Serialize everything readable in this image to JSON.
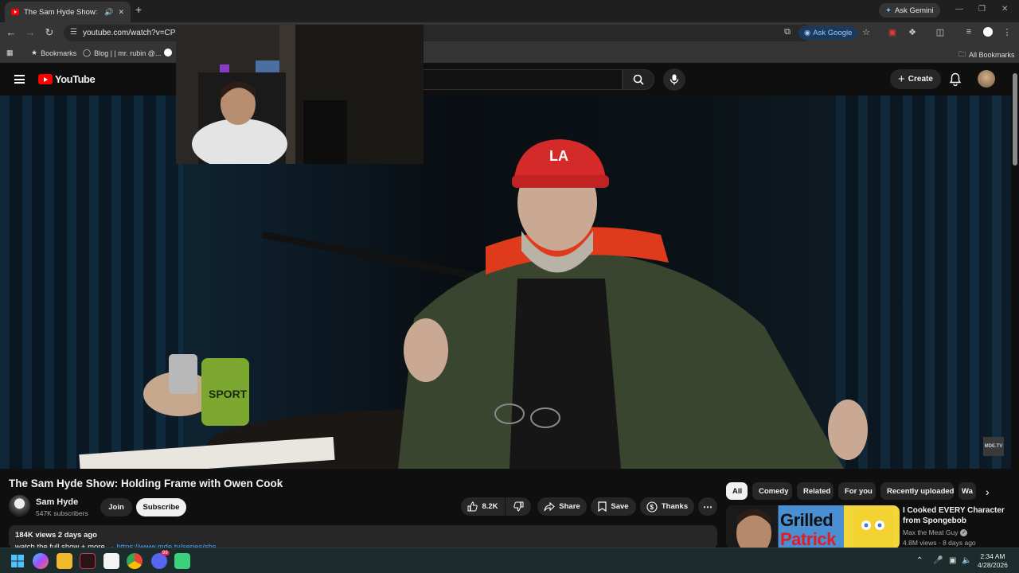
{
  "browser": {
    "tab_title": "The Sam Hyde Show: Holdi",
    "new_tab": "+",
    "ask_gemini": "Ask Gemini",
    "url": "youtube.com/watch?v=CPor",
    "ask_google": "Ask Google",
    "bookmarks": [
      {
        "label": "Bookmarks"
      },
      {
        "label": "Blog | | mr. rubin @..."
      }
    ],
    "all_bookmarks": "All Bookmarks"
  },
  "youtube": {
    "logo_text": "YouTube",
    "create_label": "Create"
  },
  "video": {
    "title": "The Sam Hyde Show: Holding Frame with Owen Cook",
    "watermark": "MDE.TV",
    "channel": {
      "name": "Sam Hyde",
      "subscribers": "547K subscribers"
    },
    "join_label": "Join",
    "subscribe_label": "Subscribe",
    "likes": "8.2K",
    "share_label": "Share",
    "save_label": "Save",
    "thanks_label": "Thanks",
    "description": {
      "meta": "184K views  2 days ago",
      "line": "watch the full show + more → ",
      "link": "https://www.mde.tv/series/shs"
    }
  },
  "chips": [
    "All",
    "Comedy",
    "Related",
    "For you",
    "Recently uploaded",
    "Wa"
  ],
  "recommendation": {
    "thumb_line1": "Grilled",
    "thumb_line2": "Patrick",
    "title": "I Cooked EVERY Character from Spongebob",
    "channel": "Max the Meat Guy",
    "views": "4.8M views · 8 days ago"
  },
  "taskbar": {
    "time": "2:34 AM",
    "date": "4/28/2026",
    "discord_badge": "99"
  },
  "colors": {
    "brand_red": "#ff0000",
    "link_blue": "#3ea6ff",
    "background": "#0f0f0f"
  }
}
